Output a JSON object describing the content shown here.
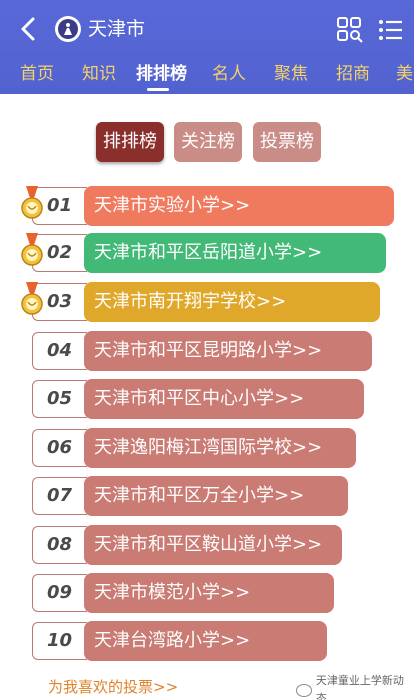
{
  "header": {
    "title": "天津市",
    "tabs": [
      {
        "label": "首页",
        "active": false
      },
      {
        "label": "知识",
        "active": false
      },
      {
        "label": "排排榜",
        "active": true
      },
      {
        "label": "名人",
        "active": false
      },
      {
        "label": "聚焦",
        "active": false
      },
      {
        "label": "招商",
        "active": false
      },
      {
        "label": "美",
        "active": false
      }
    ]
  },
  "segments": [
    {
      "label": "排排榜",
      "active": true
    },
    {
      "label": "关注榜",
      "active": false
    },
    {
      "label": "投票榜",
      "active": false
    }
  ],
  "ranking": [
    {
      "rank": "01",
      "name": "天津市实验小学>>",
      "color": "#ef7a5e",
      "medal": "gold"
    },
    {
      "rank": "02",
      "name": "天津市和平区岳阳道小学>>",
      "color": "#43b978",
      "medal": "silver"
    },
    {
      "rank": "03",
      "name": "天津市南开翔宇学校>>",
      "color": "#e0a82a",
      "medal": "bronze"
    },
    {
      "rank": "04",
      "name": "天津市和平区昆明路小学>>",
      "color": "#c97b74",
      "medal": ""
    },
    {
      "rank": "05",
      "name": "天津市和平区中心小学>>",
      "color": "#c97b74",
      "medal": ""
    },
    {
      "rank": "06",
      "name": "天津逸阳梅江湾国际学校>>",
      "color": "#c97b74",
      "medal": ""
    },
    {
      "rank": "07",
      "name": "天津市和平区万全小学>>",
      "color": "#c97b74",
      "medal": ""
    },
    {
      "rank": "08",
      "name": "天津市和平区鞍山道小学>>",
      "color": "#c97b74",
      "medal": ""
    },
    {
      "rank": "09",
      "name": "天津市模范小学>>",
      "color": "#c97b74",
      "medal": ""
    },
    {
      "rank": "10",
      "name": "天津台湾路小学>>",
      "color": "#c97b74",
      "medal": ""
    }
  ],
  "footer": {
    "vote_link": "为我喜欢的投票>>",
    "wechat_label": "天津童业上学新动态"
  },
  "colors": {
    "header_bg": "#5565d6",
    "tab_inactive": "#f3d36a",
    "segment_active": "#8a2f2c",
    "segment_inactive": "#c98c86",
    "vote_link": "#e0832c"
  }
}
